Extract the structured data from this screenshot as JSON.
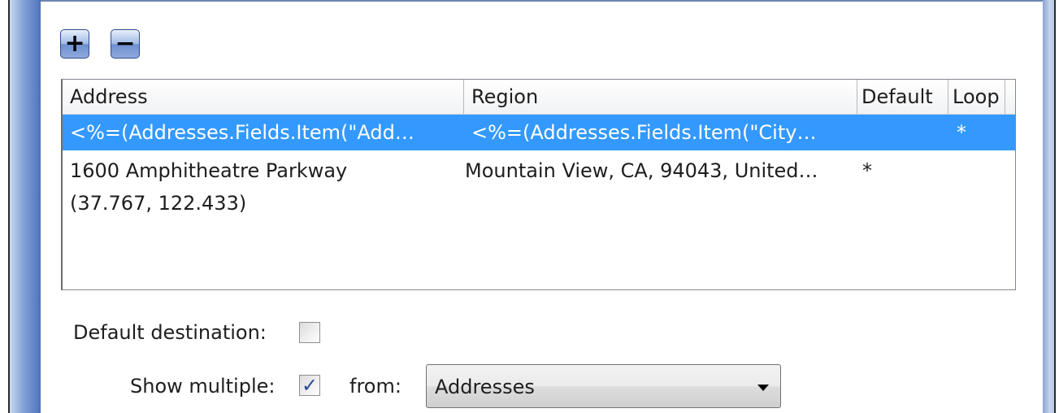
{
  "toolbar": {
    "add_label": "+",
    "remove_label": "−"
  },
  "list": {
    "columns": [
      "Address",
      "Region",
      "Default",
      "Loop"
    ],
    "rows": [
      {
        "address": "<%=(Addresses.Fields.Item(\"Add…",
        "region": "<%=(Addresses.Fields.Item(\"City…",
        "default": "",
        "loop": "*",
        "selected": true
      },
      {
        "address_line1": "1600 Amphitheatre Parkway",
        "address_line2": "(37.767, 122.433)",
        "region": "Mountain View, CA, 94043, United…",
        "default": "*",
        "loop": "",
        "selected": false
      }
    ]
  },
  "options": {
    "default_destination_label": "Default destination:",
    "default_destination_checked": false,
    "show_multiple_label": "Show multiple:",
    "show_multiple_checked": true,
    "check_mark": "✓",
    "from_label": "from:",
    "from_value": "Addresses"
  }
}
